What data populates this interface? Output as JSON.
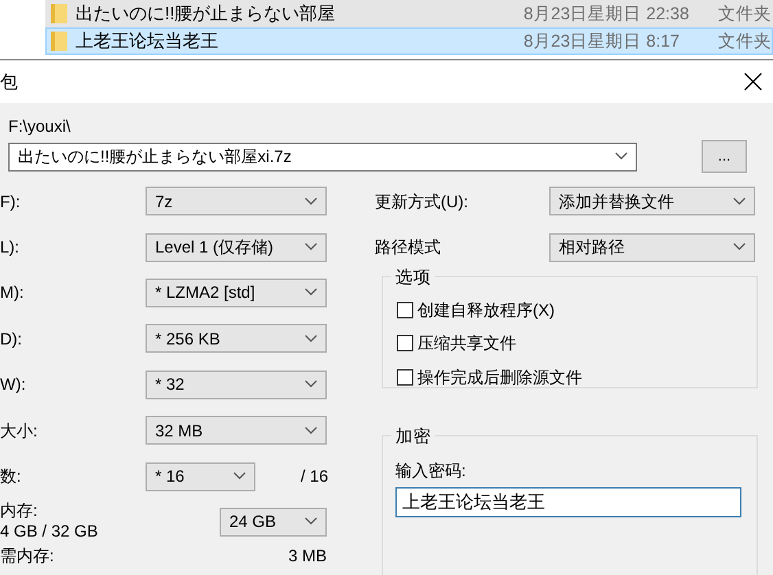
{
  "file_list": [
    {
      "name": "出たいのに!!腰が止まらない部屋",
      "modified": "8月23日星期日 22:38",
      "type": "文件夹",
      "selected": false
    },
    {
      "name": "上老王论坛当老王",
      "modified": "8月23日星期日 8:17",
      "type": "文件夹",
      "selected": true
    }
  ],
  "dialog": {
    "title": "包",
    "path_label": "F:\\youxi\\",
    "archive_name": "出たいのに!!腰が止まらない部屋xi.7z",
    "browse_button": "...",
    "left_fields": [
      {
        "kind": "combo",
        "label": "F):",
        "value": "7z"
      },
      {
        "kind": "combo",
        "label": "L):",
        "value": "Level 1 (仅存储)"
      },
      {
        "kind": "combo",
        "label": "M):",
        "value": "* LZMA2 [std]"
      },
      {
        "kind": "combo",
        "label": "D):",
        "value": "* 256 KB"
      },
      {
        "kind": "combo",
        "label": "W):",
        "value": "* 32"
      },
      {
        "kind": "combo",
        "label": "大小:",
        "value": "32 MB"
      },
      {
        "kind": "short",
        "label": "数:",
        "value": "* 16",
        "suffix": "/ 16"
      },
      {
        "kind": "memory",
        "label": "内存:",
        "sublabel": "4 GB / 32 GB",
        "value": "24 GB"
      },
      {
        "kind": "text",
        "label": "需内存:",
        "value": "3 MB"
      }
    ],
    "right_fields": [
      {
        "label": "更新方式(U):",
        "value": "添加并替换文件"
      },
      {
        "label": "路径模式",
        "value": "相对路径"
      }
    ],
    "options": {
      "title": "选项",
      "items": [
        {
          "label": "创建自释放程序(X)",
          "checked": false
        },
        {
          "label": "压缩共享文件",
          "checked": false
        },
        {
          "label": "操作完成后删除源文件",
          "checked": false
        }
      ]
    },
    "encryption": {
      "title": "加密",
      "password_label": "输入密码:",
      "password": "上老王论坛当老王"
    }
  }
}
